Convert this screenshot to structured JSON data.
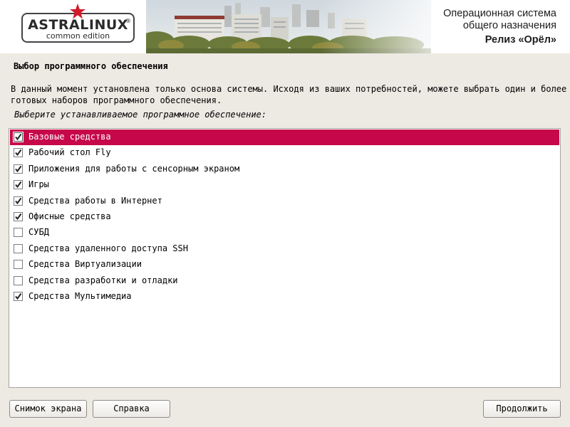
{
  "header": {
    "logo_main": "ASTRALINUX",
    "logo_reg": "®",
    "logo_sub": "common edition",
    "os_line1": "Операционная система",
    "os_line2": "общего назначения",
    "release": "Релиз «Орёл»"
  },
  "page": {
    "title": "Выбор программного обеспечения",
    "description_line1": "В данный момент установлена только основа системы. Исходя из ваших потребностей, можете выбрать один и более из",
    "description_line2": "готовых наборов программного обеспечения.",
    "prompt": "Выберите устанавливаемое программное обеспечение:"
  },
  "software_list": [
    {
      "label": "Базовые средства",
      "checked": true,
      "selected": true
    },
    {
      "label": "Рабочий стол Fly",
      "checked": true,
      "selected": false
    },
    {
      "label": "Приложения для работы с сенсорным экраном",
      "checked": true,
      "selected": false
    },
    {
      "label": "Игры",
      "checked": true,
      "selected": false
    },
    {
      "label": "Средства работы в Интернет",
      "checked": true,
      "selected": false
    },
    {
      "label": "Офисные средства",
      "checked": true,
      "selected": false
    },
    {
      "label": "СУБД",
      "checked": false,
      "selected": false
    },
    {
      "label": "Средства удаленного доступа SSH",
      "checked": false,
      "selected": false
    },
    {
      "label": "Средства Виртуализации",
      "checked": false,
      "selected": false
    },
    {
      "label": "Средства разработки и отладки",
      "checked": false,
      "selected": false
    },
    {
      "label": "Средства Мультимедиа",
      "checked": true,
      "selected": false
    }
  ],
  "buttons": {
    "screenshot": "Снимок экрана",
    "help": "Справка",
    "continue": "Продолжить"
  },
  "colors": {
    "selection": "#c6084a",
    "background": "#ede9e3",
    "logo_star": "#d11a2a"
  },
  "icons": {
    "logo_star": "star-icon",
    "checkbox_checked": "checkmark-icon"
  }
}
